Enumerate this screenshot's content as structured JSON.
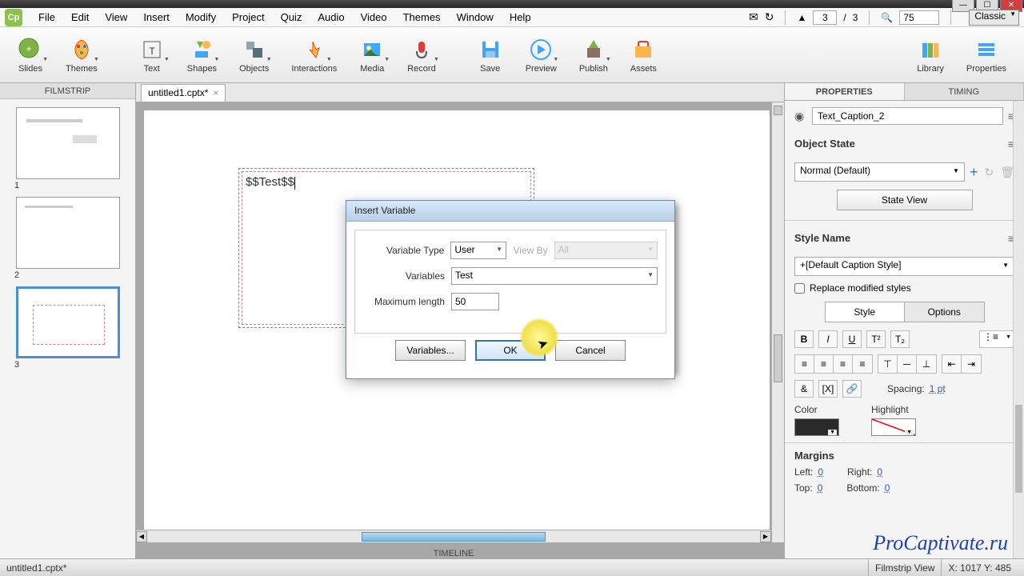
{
  "window": {
    "min": "—",
    "max": "☐",
    "close": "✕"
  },
  "menu": {
    "items": [
      "File",
      "Edit",
      "View",
      "Insert",
      "Modify",
      "Project",
      "Quiz",
      "Audio",
      "Video",
      "Themes",
      "Window",
      "Help"
    ],
    "page_current": "3",
    "page_total": "3",
    "zoom": "75",
    "theme": "Classic"
  },
  "toolbar": {
    "slides": "Slides",
    "themes": "Themes",
    "text": "Text",
    "shapes": "Shapes",
    "objects": "Objects",
    "interactions": "Interactions",
    "media": "Media",
    "record": "Record",
    "save": "Save",
    "preview": "Preview",
    "publish": "Publish",
    "assets": "Assets",
    "library": "Library",
    "properties": "Properties"
  },
  "filmstrip": {
    "header": "FILMSTRIP",
    "nums": [
      "1",
      "2",
      "3"
    ]
  },
  "doc": {
    "tab": "untitled1.cptx*",
    "caption_text": "$$Test$$"
  },
  "dialog": {
    "title": "Insert Variable",
    "type_label": "Variable Type",
    "type_value": "User",
    "viewby_label": "View By",
    "viewby_value": "All",
    "vars_label": "Variables",
    "vars_value": "Test",
    "maxlen_label": "Maximum length",
    "maxlen_value": "50",
    "variables_btn": "Variables...",
    "ok_btn": "OK",
    "cancel_btn": "Cancel"
  },
  "timeline": {
    "label": "TIMELINE"
  },
  "props": {
    "tab_properties": "PROPERTIES",
    "tab_timing": "TIMING",
    "name": "Text_Caption_2",
    "object_state": "Object State",
    "state_value": "Normal (Default)",
    "state_view": "State View",
    "style_name": "Style Name",
    "style_value": "+[Default Caption Style]",
    "replace_styles": "Replace modified styles",
    "tab_style": "Style",
    "tab_options": "Options",
    "spacing_label": "Spacing:",
    "spacing_value": "1 pt",
    "color_label": "Color",
    "highlight_label": "Highlight",
    "margins_label": "Margins",
    "left": "Left:",
    "right": "Right:",
    "top": "Top:",
    "bottom": "Bottom:",
    "zero": "0"
  },
  "status": {
    "file": "untitled1.cptx*",
    "view": "Filmstrip View",
    "coords": "X: 1017 Y: 485"
  },
  "watermark": "ProCaptivate.ru"
}
